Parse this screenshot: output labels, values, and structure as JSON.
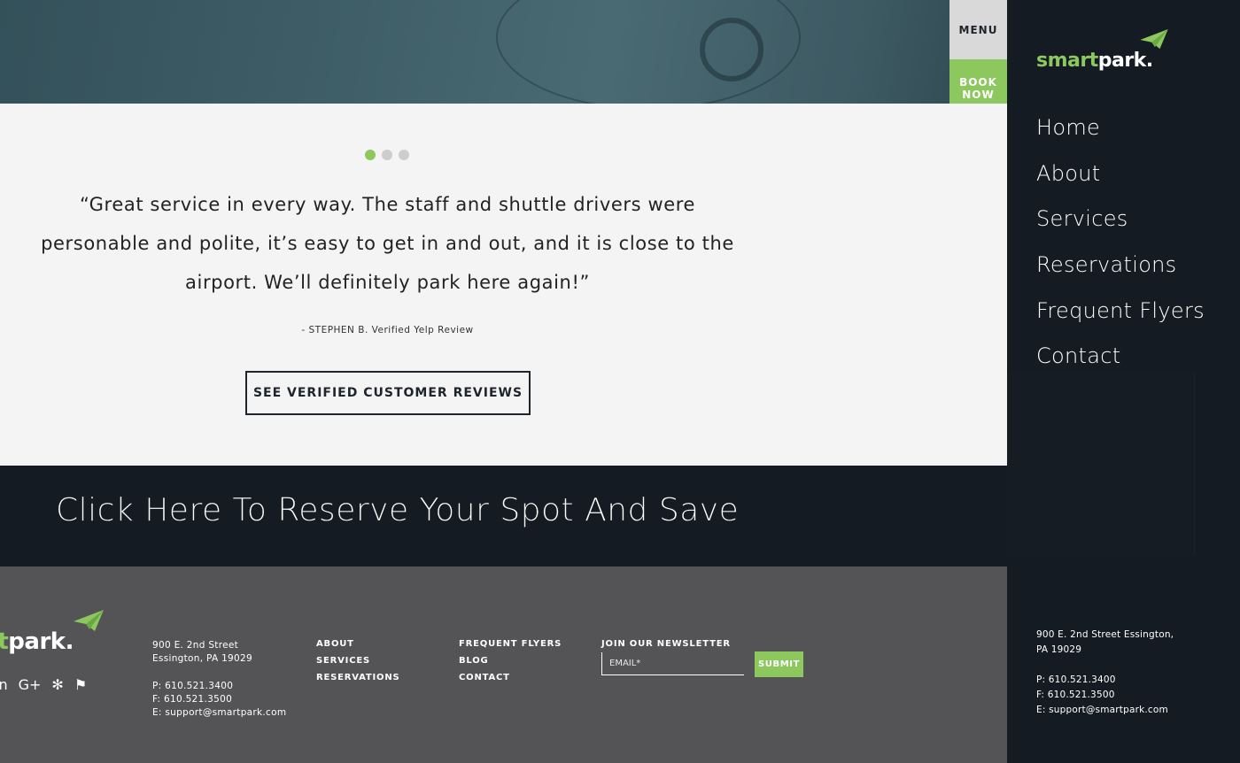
{
  "header": {
    "menu_label": "MENU",
    "book_now_label": "BOOK NOW"
  },
  "testimonial": {
    "slides_total": 3,
    "active_slide": 1,
    "quote": "“Great service in every way. The staff and shuttle drivers were personable and polite, it’s easy to get in and out, and it is close to the airport. We’ll definitely park here again!”",
    "author": "- STEPHEN B. Verified Yelp Review",
    "button_label": "SEE VERIFIED CUSTOMER REVIEWS"
  },
  "cta": {
    "text": "Click Here To Reserve Your Spot And Save"
  },
  "footer": {
    "logo_green": "art",
    "logo_white": "park.",
    "social_icons": [
      "linkedin-icon",
      "google-plus-icon",
      "yelp-icon",
      "foursquare-icon"
    ],
    "address_line1": "900 E. 2nd Street",
    "address_line2": "Essington, PA 19029",
    "phone": "P: 610.521.3400",
    "fax": "F: 610.521.3500",
    "email": "E: support@smartpark.com",
    "links_col1": [
      "ABOUT",
      "SERVICES",
      "RESERVATIONS"
    ],
    "links_col2": [
      "FREQUENT FLYERS",
      "BLOG",
      "CONTACT"
    ],
    "newsletter_title": "JOIN OUR NEWSLETTER",
    "email_placeholder": "EMAIL*",
    "submit_label": "SUBMIT"
  },
  "sidebar": {
    "brand_green": "smart",
    "brand_white": "park.",
    "nav": [
      "Home",
      "About",
      "Services",
      "Reservations",
      "Frequent Flyers",
      "Contact"
    ],
    "address_line1": "900 E. 2nd Street Essington,",
    "address_line2": "PA 19029",
    "phone": "P: 610.521.3400",
    "fax": "F: 610.521.3500",
    "email": "E: support@smartpark.com"
  },
  "colors": {
    "accent": "#8dc85f",
    "dark": "#151b22",
    "footer": "#545457",
    "panel": "#f4f4f4"
  }
}
